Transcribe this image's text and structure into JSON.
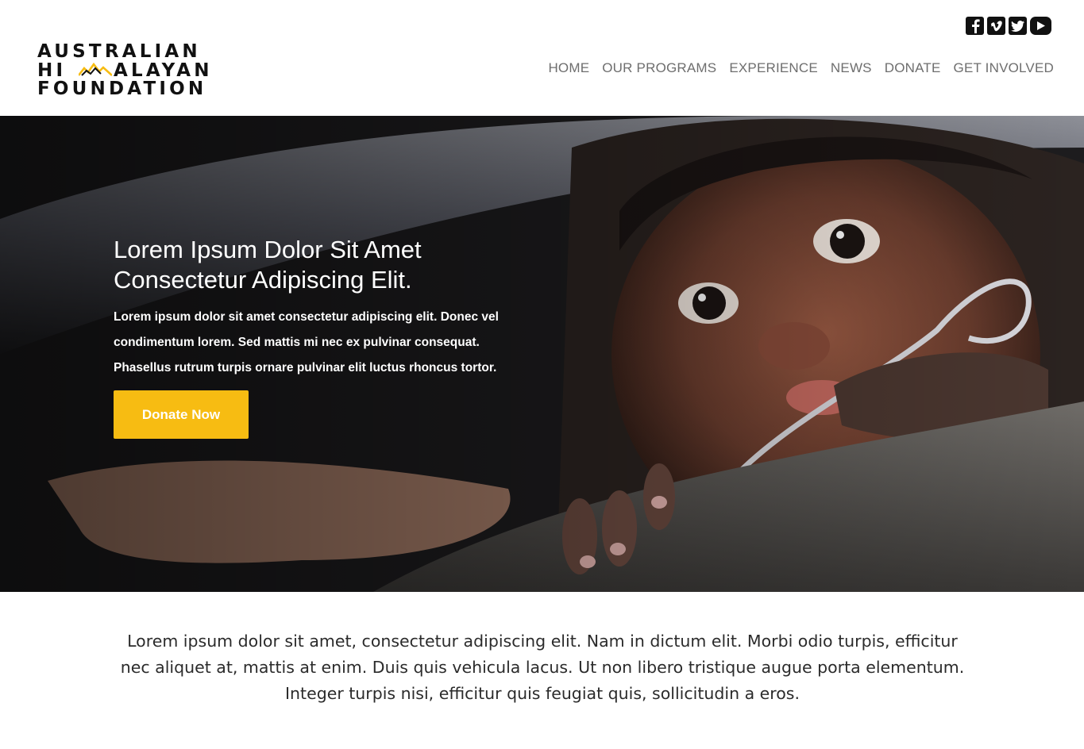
{
  "brand": {
    "logo_line1": "AUSTRALIAN",
    "logo_line2_left": "HI",
    "logo_line2_right": "ALAYAN",
    "logo_line3": "FOUNDATION",
    "accent_color": "#f7bc12"
  },
  "social": [
    {
      "name": "facebook-icon",
      "glyph": "f"
    },
    {
      "name": "vimeo-icon",
      "glyph": "v"
    },
    {
      "name": "twitter-icon",
      "glyph": "t"
    },
    {
      "name": "youtube-icon",
      "glyph": "▶"
    }
  ],
  "nav": {
    "items": [
      "HOME",
      "OUR PROGRAMS",
      "EXPERIENCE",
      "NEWS",
      "DONATE",
      "GET INVOLVED"
    ]
  },
  "hero": {
    "title_line1": "Lorem Ipsum Dolor Sit Amet",
    "title_line2": "Consectetur Adipiscing Elit.",
    "text": "Lorem ipsum dolor sit amet consectetur adipiscing elit. Donec vel condimentum lorem. Sed mattis mi nec ex pulvinar consequat. Phasellus rutrum turpis ornare pulvinar elit luctus rhoncus tortor.",
    "button_label": "Donate Now"
  },
  "intro": {
    "text": "Lorem ipsum dolor sit amet, consectetur adipiscing elit. Nam in dictum elit. Morbi odio turpis, efficitur nec aliquet at, mattis at enim. Duis quis vehicula lacus. Ut non libero tristique augue porta elementum. Integer turpis nisi, efficitur quis feugiat quis, sollicitudin a eros."
  }
}
